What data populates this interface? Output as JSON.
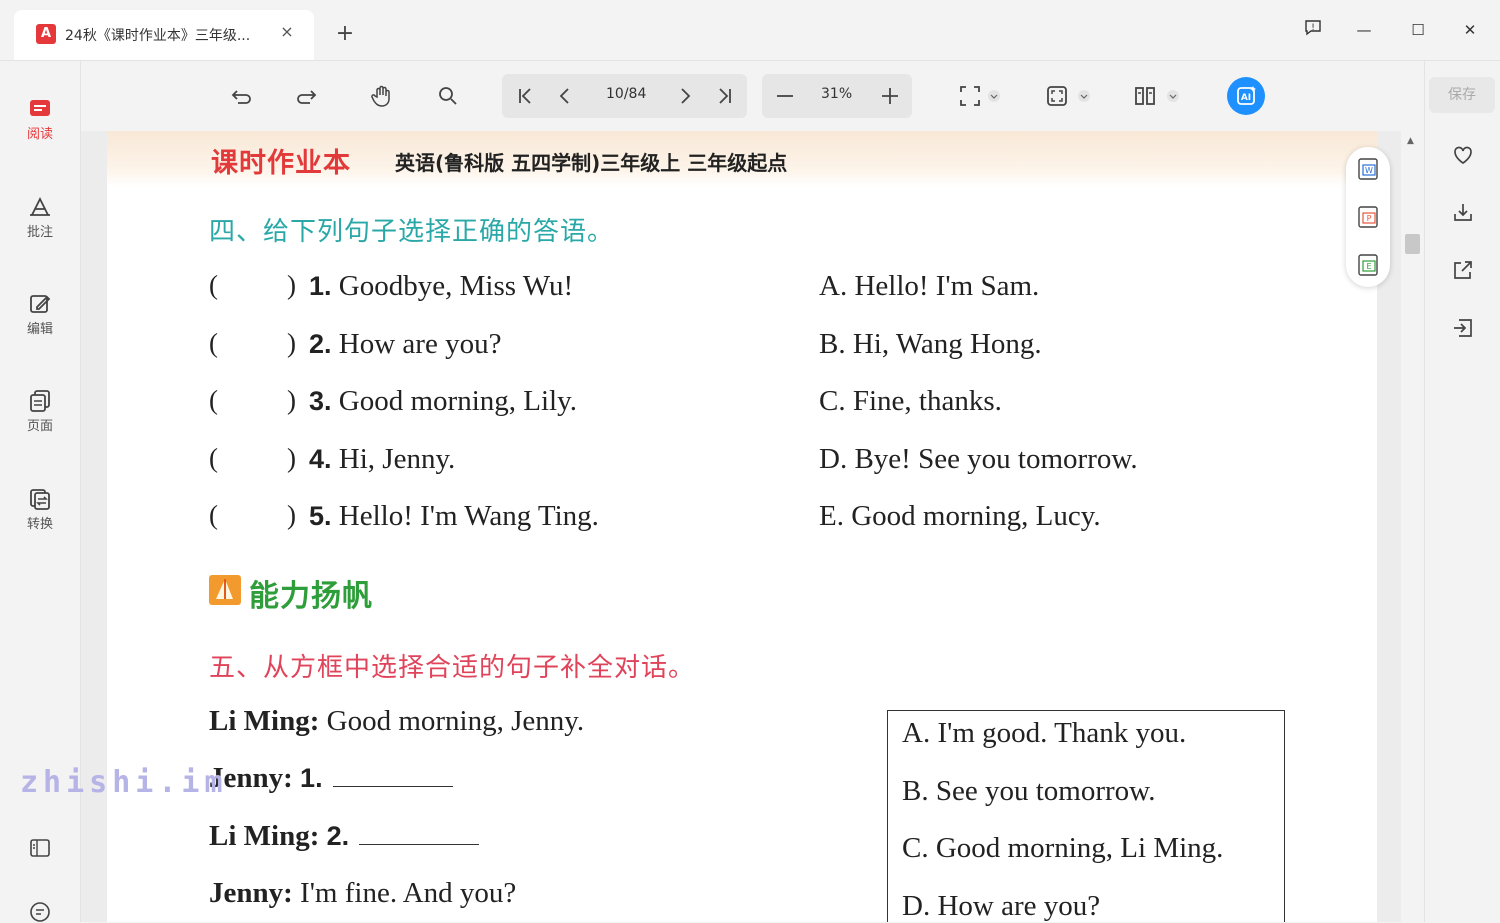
{
  "tab": {
    "icon_label": "A",
    "title": "24秋《课时作业本》三年级...",
    "close": "×",
    "new_tab": "+"
  },
  "window": {
    "feedback": "!",
    "minimize": "—",
    "maximize": "☐",
    "close": "✕"
  },
  "sidebar": {
    "items": [
      {
        "label": "阅读",
        "icon": "read-icon",
        "active": true
      },
      {
        "label": "批注",
        "icon": "annotate-icon",
        "active": false
      },
      {
        "label": "编辑",
        "icon": "edit-icon",
        "active": false
      },
      {
        "label": "页面",
        "icon": "pages-icon",
        "active": false
      },
      {
        "label": "转换",
        "icon": "convert-icon",
        "active": false
      }
    ]
  },
  "toolbar": {
    "page_indicator": "10/84",
    "zoom": "31%"
  },
  "rightbar": {
    "save_label": "保存"
  },
  "document": {
    "brand": "课时作业本",
    "subject": "英语(鲁科版 五四学制)三年级上 三年级起点",
    "section4_title": "四、给下列句子选择正确的答语。",
    "questions": [
      {
        "num": "1.",
        "text": "Goodbye, Miss Wu!"
      },
      {
        "num": "2.",
        "text": "How are you?"
      },
      {
        "num": "3.",
        "text": "Good morning, Lily."
      },
      {
        "num": "4.",
        "text": "Hi, Jenny."
      },
      {
        "num": "5.",
        "text": "Hello! I'm Wang Ting."
      }
    ],
    "answers": [
      "A.  Hello! I'm Sam.",
      "B.  Hi, Wang Hong.",
      "C.  Fine, thanks.",
      "D.  Bye! See you tomorrow.",
      "E.  Good morning, Lucy."
    ],
    "paren_open": "(",
    "paren_close": ")",
    "ability_title": "能力扬帆",
    "section5_title": "五、从方框中选择合适的句子补全对话。",
    "dialogue": [
      {
        "speaker": "Li Ming:",
        "text": "Good morning, Jenny."
      },
      {
        "speaker": "Jenny:",
        "text": "1."
      },
      {
        "speaker": "Li Ming:",
        "text": "2."
      },
      {
        "speaker": "Jenny:",
        "text": "I'm fine.  And you?"
      }
    ],
    "box_options": [
      "A.  I'm good.  Thank you.",
      "B.  See you tomorrow.",
      "C.  Good morning, Li Ming.",
      "D.  How are you?"
    ]
  },
  "watermark": "zhishi.im",
  "colors": {
    "accent_red": "#e5383b",
    "teal_title": "#2aa8a8",
    "pink_title": "#e0445a",
    "green_title": "#2e9e3a",
    "ai_blue": "#1e90ff"
  }
}
